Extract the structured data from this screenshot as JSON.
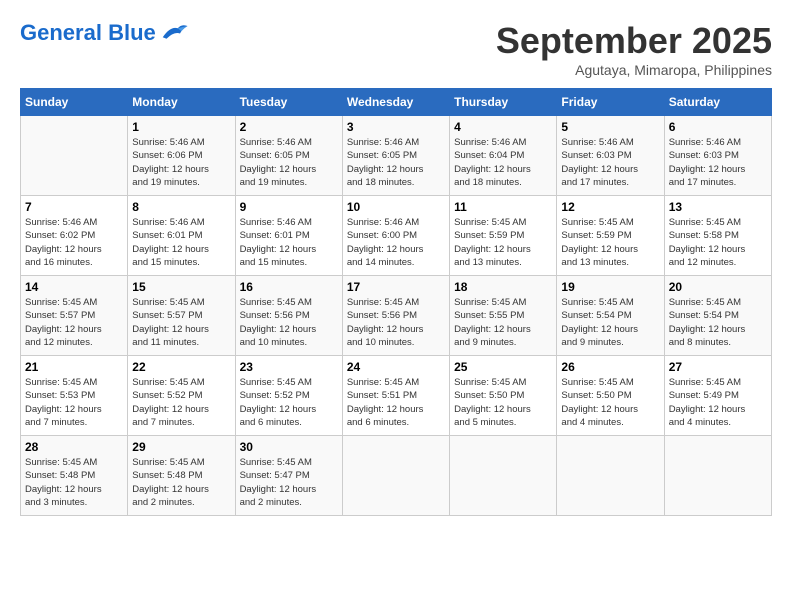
{
  "header": {
    "logo_general": "General",
    "logo_blue": "Blue",
    "month_title": "September 2025",
    "location": "Agutaya, Mimaropa, Philippines"
  },
  "weekdays": [
    "Sunday",
    "Monday",
    "Tuesday",
    "Wednesday",
    "Thursday",
    "Friday",
    "Saturday"
  ],
  "weeks": [
    [
      {
        "day": "",
        "info": ""
      },
      {
        "day": "1",
        "info": "Sunrise: 5:46 AM\nSunset: 6:06 PM\nDaylight: 12 hours\nand 19 minutes."
      },
      {
        "day": "2",
        "info": "Sunrise: 5:46 AM\nSunset: 6:05 PM\nDaylight: 12 hours\nand 19 minutes."
      },
      {
        "day": "3",
        "info": "Sunrise: 5:46 AM\nSunset: 6:05 PM\nDaylight: 12 hours\nand 18 minutes."
      },
      {
        "day": "4",
        "info": "Sunrise: 5:46 AM\nSunset: 6:04 PM\nDaylight: 12 hours\nand 18 minutes."
      },
      {
        "day": "5",
        "info": "Sunrise: 5:46 AM\nSunset: 6:03 PM\nDaylight: 12 hours\nand 17 minutes."
      },
      {
        "day": "6",
        "info": "Sunrise: 5:46 AM\nSunset: 6:03 PM\nDaylight: 12 hours\nand 17 minutes."
      }
    ],
    [
      {
        "day": "7",
        "info": "Sunrise: 5:46 AM\nSunset: 6:02 PM\nDaylight: 12 hours\nand 16 minutes."
      },
      {
        "day": "8",
        "info": "Sunrise: 5:46 AM\nSunset: 6:01 PM\nDaylight: 12 hours\nand 15 minutes."
      },
      {
        "day": "9",
        "info": "Sunrise: 5:46 AM\nSunset: 6:01 PM\nDaylight: 12 hours\nand 15 minutes."
      },
      {
        "day": "10",
        "info": "Sunrise: 5:46 AM\nSunset: 6:00 PM\nDaylight: 12 hours\nand 14 minutes."
      },
      {
        "day": "11",
        "info": "Sunrise: 5:45 AM\nSunset: 5:59 PM\nDaylight: 12 hours\nand 13 minutes."
      },
      {
        "day": "12",
        "info": "Sunrise: 5:45 AM\nSunset: 5:59 PM\nDaylight: 12 hours\nand 13 minutes."
      },
      {
        "day": "13",
        "info": "Sunrise: 5:45 AM\nSunset: 5:58 PM\nDaylight: 12 hours\nand 12 minutes."
      }
    ],
    [
      {
        "day": "14",
        "info": "Sunrise: 5:45 AM\nSunset: 5:57 PM\nDaylight: 12 hours\nand 12 minutes."
      },
      {
        "day": "15",
        "info": "Sunrise: 5:45 AM\nSunset: 5:57 PM\nDaylight: 12 hours\nand 11 minutes."
      },
      {
        "day": "16",
        "info": "Sunrise: 5:45 AM\nSunset: 5:56 PM\nDaylight: 12 hours\nand 10 minutes."
      },
      {
        "day": "17",
        "info": "Sunrise: 5:45 AM\nSunset: 5:56 PM\nDaylight: 12 hours\nand 10 minutes."
      },
      {
        "day": "18",
        "info": "Sunrise: 5:45 AM\nSunset: 5:55 PM\nDaylight: 12 hours\nand 9 minutes."
      },
      {
        "day": "19",
        "info": "Sunrise: 5:45 AM\nSunset: 5:54 PM\nDaylight: 12 hours\nand 9 minutes."
      },
      {
        "day": "20",
        "info": "Sunrise: 5:45 AM\nSunset: 5:54 PM\nDaylight: 12 hours\nand 8 minutes."
      }
    ],
    [
      {
        "day": "21",
        "info": "Sunrise: 5:45 AM\nSunset: 5:53 PM\nDaylight: 12 hours\nand 7 minutes."
      },
      {
        "day": "22",
        "info": "Sunrise: 5:45 AM\nSunset: 5:52 PM\nDaylight: 12 hours\nand 7 minutes."
      },
      {
        "day": "23",
        "info": "Sunrise: 5:45 AM\nSunset: 5:52 PM\nDaylight: 12 hours\nand 6 minutes."
      },
      {
        "day": "24",
        "info": "Sunrise: 5:45 AM\nSunset: 5:51 PM\nDaylight: 12 hours\nand 6 minutes."
      },
      {
        "day": "25",
        "info": "Sunrise: 5:45 AM\nSunset: 5:50 PM\nDaylight: 12 hours\nand 5 minutes."
      },
      {
        "day": "26",
        "info": "Sunrise: 5:45 AM\nSunset: 5:50 PM\nDaylight: 12 hours\nand 4 minutes."
      },
      {
        "day": "27",
        "info": "Sunrise: 5:45 AM\nSunset: 5:49 PM\nDaylight: 12 hours\nand 4 minutes."
      }
    ],
    [
      {
        "day": "28",
        "info": "Sunrise: 5:45 AM\nSunset: 5:48 PM\nDaylight: 12 hours\nand 3 minutes."
      },
      {
        "day": "29",
        "info": "Sunrise: 5:45 AM\nSunset: 5:48 PM\nDaylight: 12 hours\nand 2 minutes."
      },
      {
        "day": "30",
        "info": "Sunrise: 5:45 AM\nSunset: 5:47 PM\nDaylight: 12 hours\nand 2 minutes."
      },
      {
        "day": "",
        "info": ""
      },
      {
        "day": "",
        "info": ""
      },
      {
        "day": "",
        "info": ""
      },
      {
        "day": "",
        "info": ""
      }
    ]
  ]
}
